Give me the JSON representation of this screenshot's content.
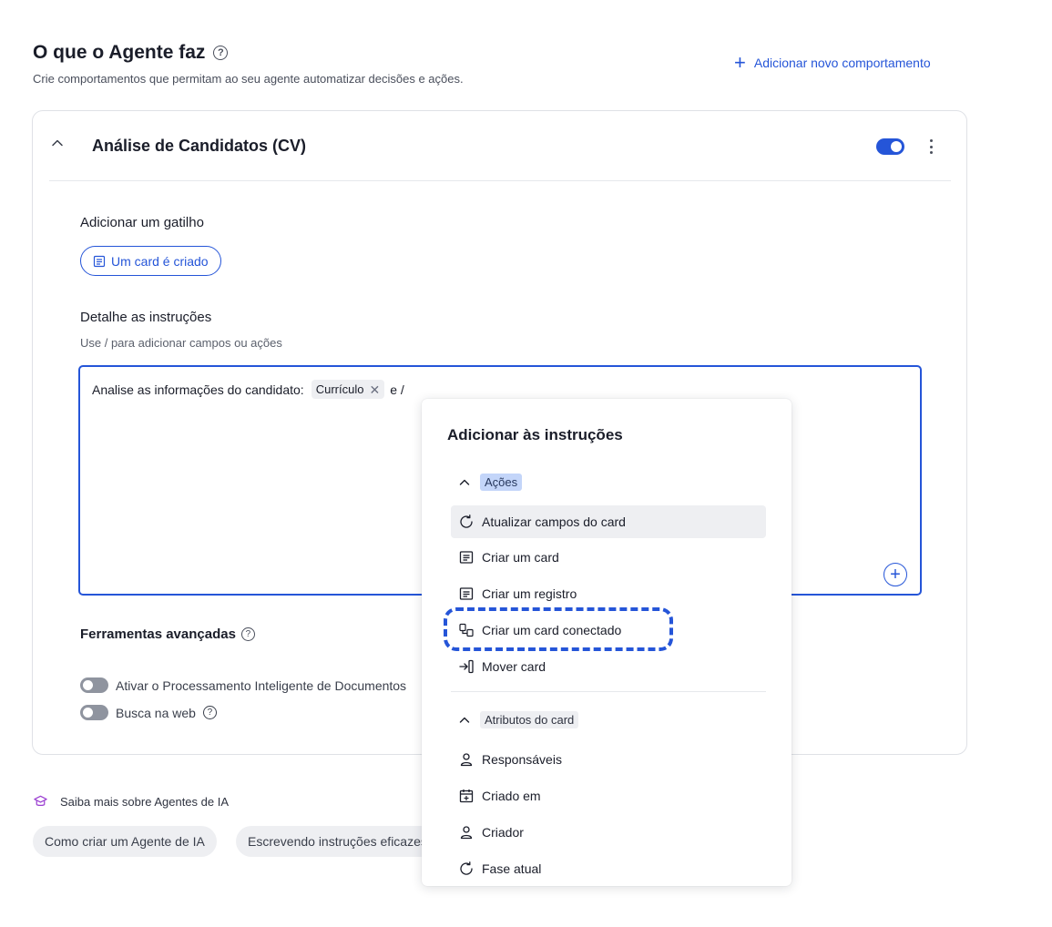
{
  "header": {
    "title": "O que o Agente faz",
    "subtitle": "Crie comportamentos que permitam ao seu agente automatizar decisões e ações.",
    "add_behavior_label": "Adicionar novo comportamento"
  },
  "behavior": {
    "title": "Análise de Candidatos (CV)",
    "enabled": true,
    "trigger_section_label": "Adicionar um gatilho",
    "trigger_chip_label": "Um card é criado",
    "instructions_label": "Detalhe as instruções",
    "instructions_hint": "Use / para adicionar campos ou ações",
    "instructions_text_before": "Analise as informações do candidato:",
    "instructions_field_chip": "Currículo",
    "instructions_text_after": "e /",
    "advanced_label": "Ferramentas avançadas",
    "tools": [
      {
        "label": "Ativar o Processamento Inteligente de Documentos",
        "enabled": false
      },
      {
        "label": "Busca na web",
        "enabled": false
      }
    ]
  },
  "learn_more": {
    "label": "Saiba mais sobre Agentes de IA",
    "links": [
      "Como criar um Agente de IA",
      "Escrevendo instruções eficazes"
    ]
  },
  "menu": {
    "title": "Adicionar às instruções",
    "groups": [
      {
        "label": "Ações",
        "items": [
          {
            "label": "Atualizar campos do card",
            "icon": "refresh-icon"
          },
          {
            "label": "Criar um card",
            "icon": "card-icon"
          },
          {
            "label": "Criar um registro",
            "icon": "record-icon"
          },
          {
            "label": "Criar um card conectado",
            "icon": "connected-card-icon"
          },
          {
            "label": "Mover card",
            "icon": "move-icon"
          }
        ]
      },
      {
        "label": "Atributos do card",
        "items": [
          {
            "label": "Responsáveis",
            "icon": "user-icon"
          },
          {
            "label": "Criado em",
            "icon": "calendar-icon"
          },
          {
            "label": "Criador",
            "icon": "user-icon"
          },
          {
            "label": "Fase atual",
            "icon": "refresh-icon"
          }
        ]
      }
    ]
  },
  "colors": {
    "accent": "#2555d8",
    "tag_highlight": "#c3d5f9",
    "chip_bg": "#eeeff2"
  }
}
